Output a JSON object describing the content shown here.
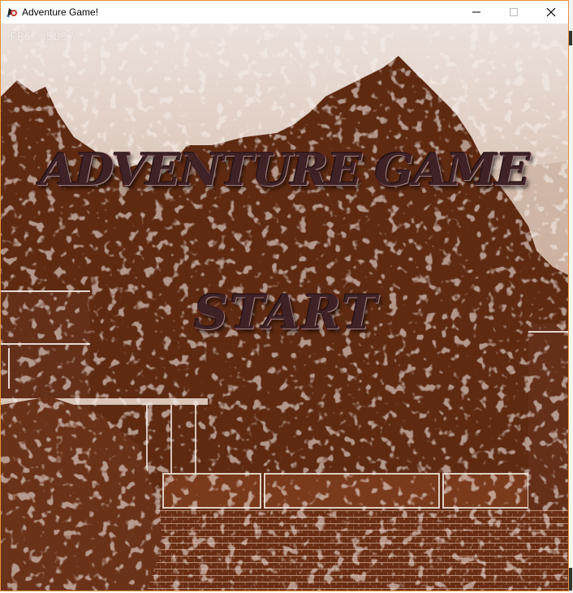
{
  "window": {
    "title": "Adventure Game!",
    "controls": {
      "minimize_glyph": "—",
      "maximize_glyph": "☐",
      "close_glyph": "✕"
    },
    "accent_border_color": "#e6923a"
  },
  "hud": {
    "fps_text": "FPS: 5037"
  },
  "menu": {
    "game_title": "ADVENTURE GAME",
    "start_label": "START"
  },
  "colors": {
    "background_brown": "#5e2a12",
    "sky_light": "#ece2dc",
    "title_text": "#3e2226",
    "title_glow": "#c03a46"
  },
  "icons": {
    "app_icon": "java-duke-icon"
  }
}
